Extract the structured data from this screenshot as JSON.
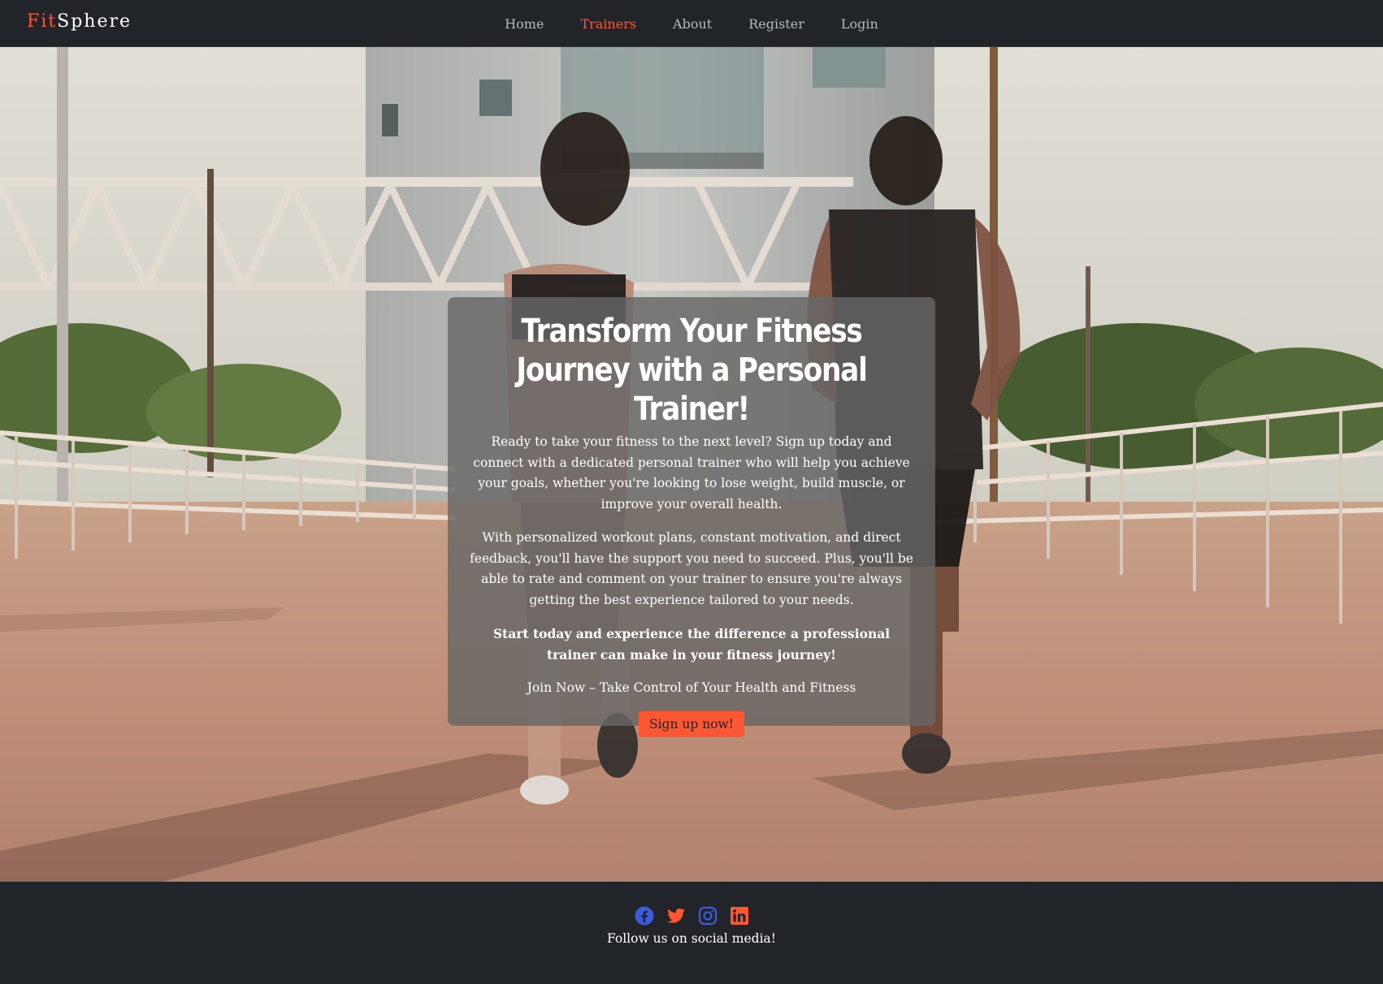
{
  "brand": {
    "part1": "Fit",
    "part2": "Sphere"
  },
  "nav": {
    "items": [
      {
        "label": "Home",
        "active": false
      },
      {
        "label": "Trainers",
        "active": true
      },
      {
        "label": "About",
        "active": false
      },
      {
        "label": "Register",
        "active": false
      },
      {
        "label": "Login",
        "active": false
      }
    ]
  },
  "hero": {
    "title": "Transform Your Fitness Journey with a Personal Trainer!",
    "paragraph1": "Ready to take your fitness to the next level? Sign up today and connect with a dedicated personal trainer who will help you achieve your goals, whether you're looking to lose weight, build muscle, or improve your overall health.",
    "paragraph2": "With personalized workout plans, constant motivation, and direct feedback, you'll have the support you need to succeed. Plus, you'll be able to rate and comment on your trainer to ensure you're always getting the best experience tailored to your needs.",
    "paragraph3": "Start today and experience the difference a professional trainer can make in your fitness journey!",
    "paragraph4": "Join Now – Take Control of Your Health and Fitness",
    "cta_label": "Sign up now!"
  },
  "footer": {
    "socials": [
      {
        "icon": "facebook-icon",
        "color": "#3b5bdb"
      },
      {
        "icon": "twitter-icon",
        "color": "#ff5733"
      },
      {
        "icon": "instagram-icon",
        "color": "#3b5bdb"
      },
      {
        "icon": "linkedin-icon",
        "color": "#ff5733"
      }
    ],
    "follow_text": "Follow us on social media!"
  },
  "colors": {
    "accent": "#ff5733",
    "navbar_bg": "#212529",
    "nav_link": "#b7babd",
    "social_blue": "#3b5bdb"
  }
}
